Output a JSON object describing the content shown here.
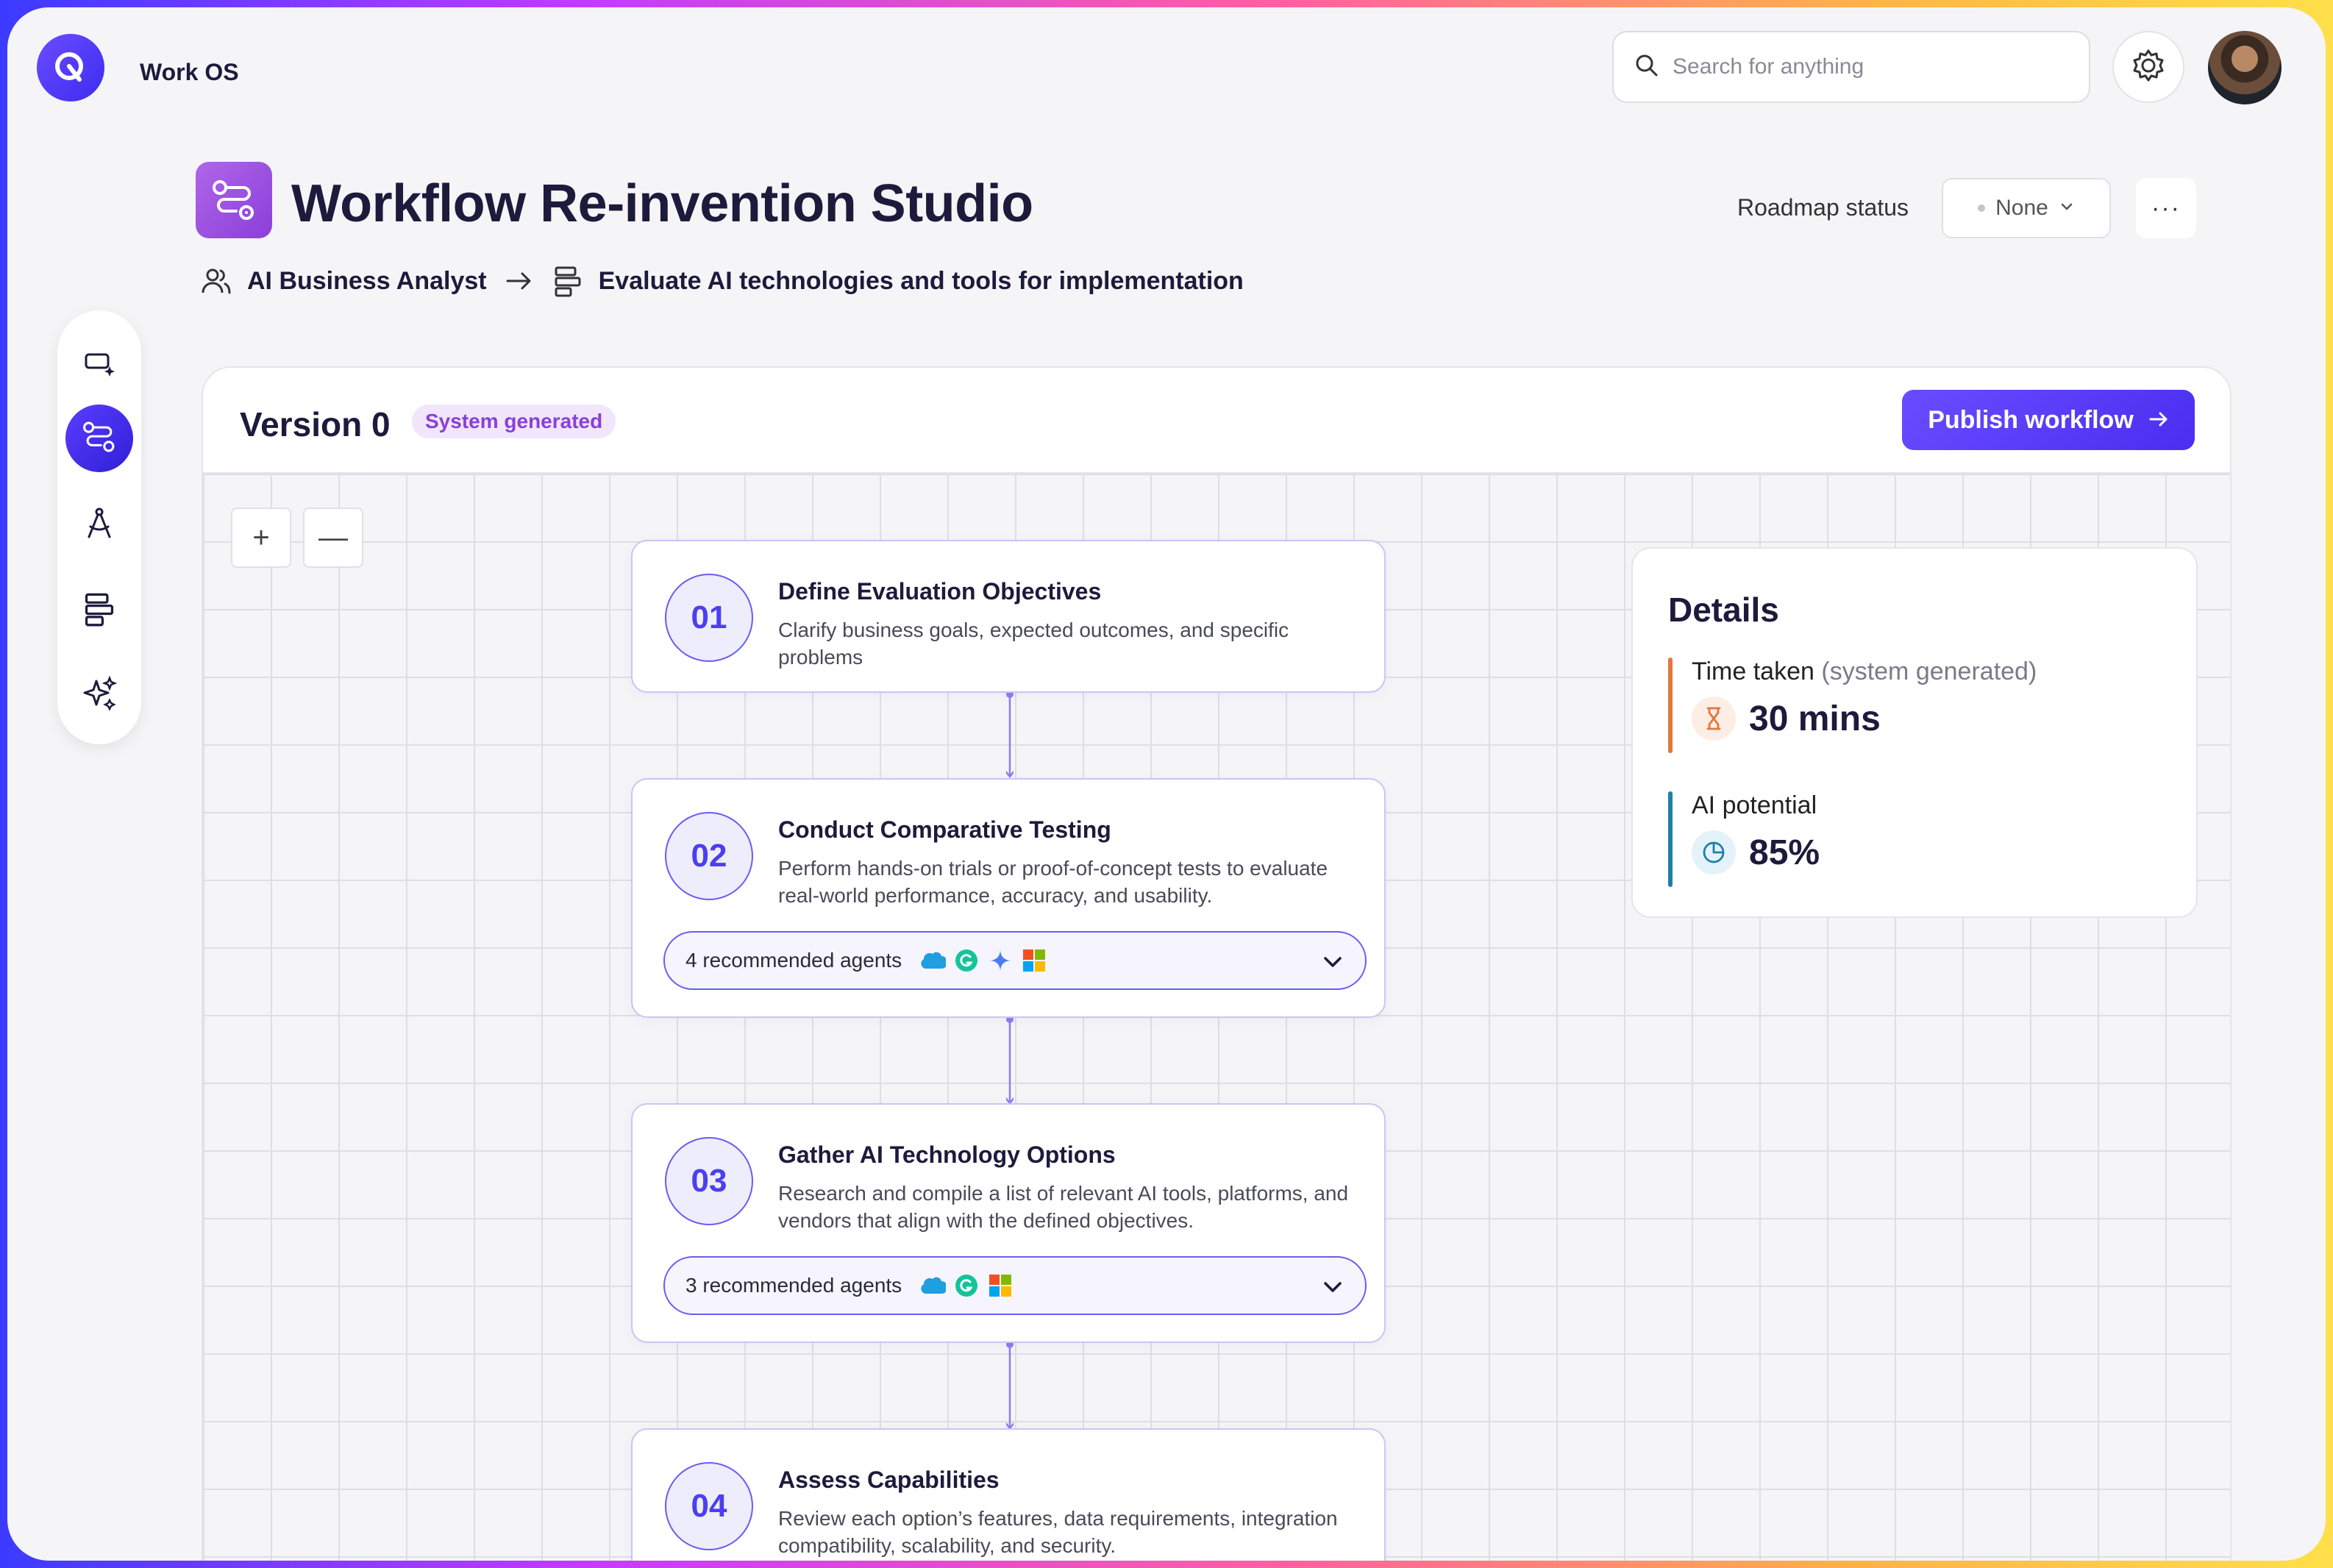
{
  "app": {
    "name": "Work OS"
  },
  "search": {
    "placeholder": "Search for anything"
  },
  "page": {
    "title": "Workflow Re-invention Studio",
    "breadcrumb": {
      "role": "AI Business Analyst",
      "task": "Evaluate AI technologies and tools for implementation"
    },
    "roadmap": {
      "label": "Roadmap status",
      "value": "None"
    },
    "more_label": "···"
  },
  "version": {
    "title": "Version 0",
    "badge": "System generated",
    "publish_label": "Publish workflow"
  },
  "zoom": {
    "in": "+",
    "out": "—"
  },
  "steps": [
    {
      "number": "01",
      "title": "Define Evaluation Objectives",
      "description": "Clarify business goals, expected outcomes, and specific problems"
    },
    {
      "number": "02",
      "title": "Conduct Comparative Testing",
      "description": "Perform hands-on trials or proof-of-concept tests to evaluate real-world performance, accuracy, and usability.",
      "agents_label": "4 recommended agents",
      "agent_icons": [
        "salesforce-icon",
        "grammarly-icon",
        "gemini-icon",
        "microsoft-icon"
      ]
    },
    {
      "number": "03",
      "title": "Gather AI Technology Options",
      "description": "Research and compile a list of relevant AI tools, platforms, and vendors that align with the defined objectives.",
      "agents_label": "3 recommended agents",
      "agent_icons": [
        "salesforce-icon",
        "grammarly-icon",
        "microsoft-icon"
      ]
    },
    {
      "number": "04",
      "title": "Assess Capabilities",
      "description": "Review each option’s features, data requirements, integration compatibility, scalability, and security."
    }
  ],
  "details": {
    "title": "Details",
    "time": {
      "label": "Time taken",
      "sublabel": "(system generated)",
      "value": "30 mins",
      "color": "#e0793f"
    },
    "ai": {
      "label": "AI potential",
      "value": "85%",
      "color": "#1f7fa8"
    }
  },
  "colors": {
    "accent": "#5a3dff",
    "title_icon": "#9b4fe0",
    "step_border": "#c9c6f2"
  }
}
